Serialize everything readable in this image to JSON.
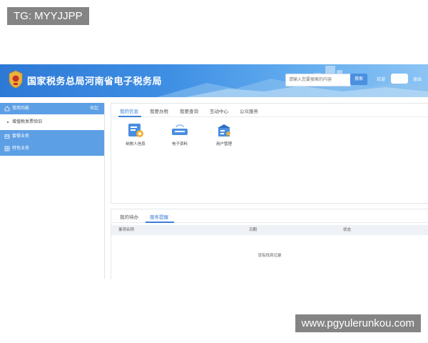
{
  "watermarks": {
    "top": "TG: MYYJJPP",
    "bottom": "www.pgyulerunkou.com"
  },
  "header": {
    "title": "国家税务总局河南省电子税务局",
    "search_placeholder": "请输入您要搜索的内容",
    "search_button": "搜索",
    "welcome": "欢迎",
    "logout": "退出"
  },
  "sidebar": {
    "common_functions": "常用功能",
    "collapse": "收起",
    "sub_item": "增值税发票验旧",
    "menu_items": [
      "套餐业务",
      "特色业务"
    ]
  },
  "top_panel": {
    "tabs": [
      "我的信息",
      "我要办税",
      "我要查询",
      "互动中心",
      "公众服务"
    ],
    "active_tab": 0,
    "tiles": [
      {
        "label": "纳税人信息",
        "icon": "taxpayer-info-icon"
      },
      {
        "label": "电子资料",
        "icon": "electronic-data-icon"
      },
      {
        "label": "用户管理",
        "icon": "user-management-icon"
      }
    ]
  },
  "bottom_panel": {
    "tabs": [
      "我的待办",
      "服务提醒"
    ],
    "active_tab": 1,
    "columns": [
      "事项名称",
      "日期",
      "状态"
    ],
    "empty_text": "没有找到记录"
  },
  "colors": {
    "accent": "#3c7fd6",
    "sidebar_blue": "#5d9fe5",
    "header_start": "#2d79d6",
    "header_end": "#8cc4f4"
  }
}
